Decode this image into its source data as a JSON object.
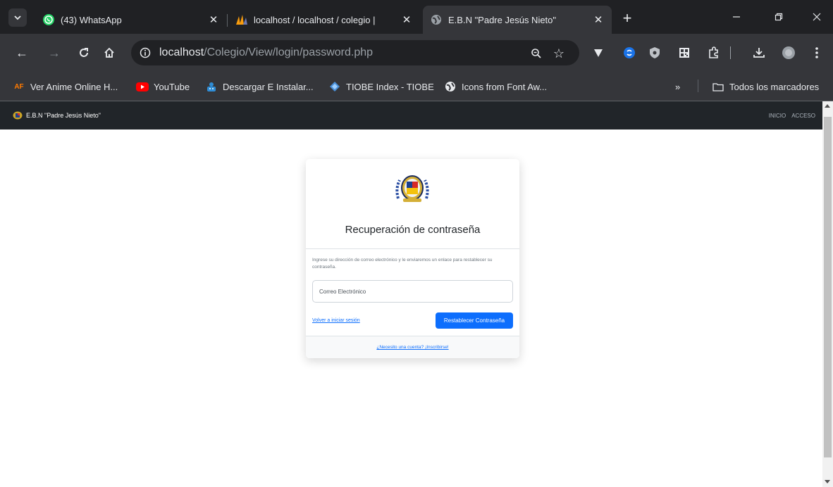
{
  "browser": {
    "tabs": [
      {
        "title": "(43) WhatsApp",
        "icon": "whatsapp-icon",
        "active": false
      },
      {
        "title": "localhost / localhost / colegio |",
        "icon": "phpmyadmin-icon",
        "active": false
      },
      {
        "title": "E.B.N \"Padre Jesús Nieto\"",
        "icon": "globe-icon",
        "active": true
      }
    ],
    "address": {
      "host": "localhost",
      "path": "/Colegio/View/login/password.php"
    },
    "bookmarks": [
      {
        "label": "Ver Anime Online H...",
        "icon": "AF"
      },
      {
        "label": "YouTube",
        "icon": "youtube-icon"
      },
      {
        "label": "Descargar E Instalar...",
        "icon": "robot-icon"
      },
      {
        "label": "TIOBE Index - TIOBE",
        "icon": "tiobe-icon"
      },
      {
        "label": "Icons from Font Aw...",
        "icon": "globe-icon"
      }
    ],
    "bookmarks_folder": "Todos los marcadores",
    "colors": {
      "frame": "#202124",
      "toolbar": "#35363a",
      "accent": "#0d6efd"
    }
  },
  "page": {
    "navbar": {
      "brand": "E.B.N \"Padre Jesús Nieto\"",
      "links": [
        "INICIO",
        "ACCESO"
      ]
    },
    "card": {
      "title": "Recuperación de contraseña",
      "description": "Ingrese su dirección de correo electrónico y le enviaremos un enlace para restablecer su contraseña.",
      "email_placeholder": "Correo Electrónico",
      "back_link": "Volver a iniciar sesión",
      "submit_label": "Restablecer Contraseña",
      "footer_link": "¿Necesito una cuenta? ¡Inscribirse!"
    }
  }
}
